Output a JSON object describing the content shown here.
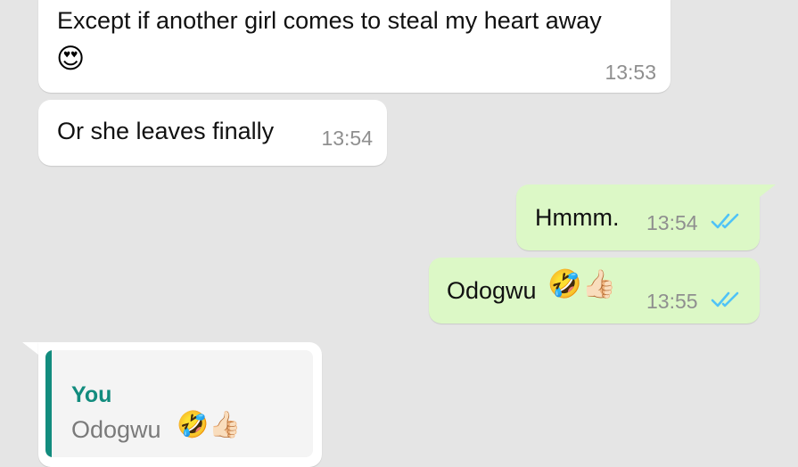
{
  "colors": {
    "chat_background": "#e5e5e5",
    "incoming_bubble": "#ffffff",
    "outgoing_bubble": "#dcf8c6",
    "read_ticks": "#4fc3f7",
    "quote_accent": "#128c7e",
    "timestamp": "#8f8f8f"
  },
  "messages": [
    {
      "direction": "incoming",
      "text": "Except if another girl comes to steal my heart away",
      "emoji": "😍",
      "emoji_name": "heart-eyes-emoji",
      "time": "13:53"
    },
    {
      "direction": "incoming",
      "text": "Or she leaves finally",
      "time": "13:54"
    },
    {
      "direction": "outgoing",
      "text": "Hmmm.",
      "time": "13:54",
      "status": "read",
      "status_icon": "double-check-icon"
    },
    {
      "direction": "outgoing",
      "text": "Odogwu",
      "emoji": "🤣👍🏻",
      "emoji_name": "rofl-thumbs-up-emoji",
      "time": "13:55",
      "status": "read",
      "status_icon": "double-check-icon"
    },
    {
      "direction": "incoming",
      "reply_to": {
        "author": "You",
        "text": "Odogwu",
        "emoji": "🤣👍🏻"
      }
    }
  ]
}
